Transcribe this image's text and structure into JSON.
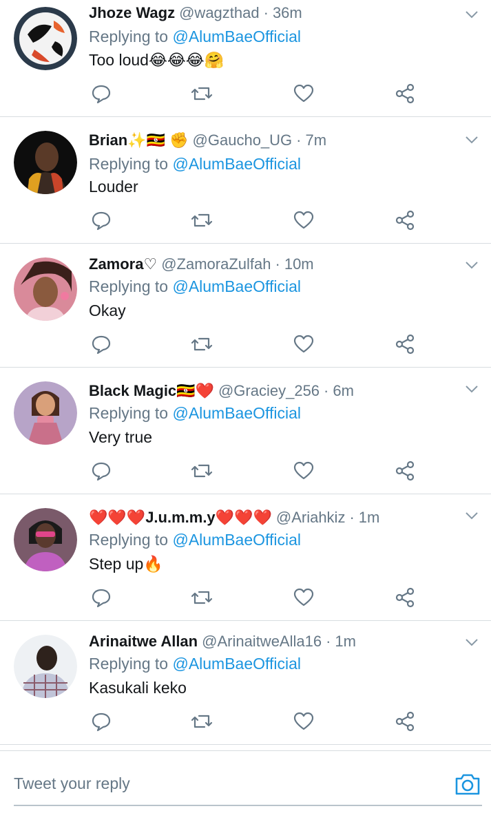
{
  "replies": [
    {
      "name": "Jhoze Wagz",
      "name_emoji": "",
      "handle": "@wagzthad",
      "time": "36m",
      "replying_label": "Replying to",
      "mention": "@AlumBaeOfficial",
      "text": "Too loud😂😂😂🤗",
      "avatar_icon": "ball-avatar"
    },
    {
      "name": "Brian",
      "name_emoji": "✨🇺🇬 ✊",
      "handle": "@Gaucho_UG",
      "time": "7m",
      "replying_label": "Replying to",
      "mention": "@AlumBaeOfficial",
      "text": "Louder",
      "avatar_icon": "person-avatar"
    },
    {
      "name": "Zamora",
      "name_emoji": "♡",
      "handle": "@ZamoraZulfah",
      "time": "10m",
      "replying_label": "Replying to",
      "mention": "@AlumBaeOfficial",
      "text": "Okay",
      "avatar_icon": "person-avatar"
    },
    {
      "name": "Black Magic",
      "name_emoji": "🇺🇬❤️",
      "handle": "@Graciey_256",
      "time": "6m",
      "replying_label": "Replying to",
      "mention": "@AlumBaeOfficial",
      "text": "Very true",
      "avatar_icon": "doll-avatar"
    },
    {
      "name": "J.u.m.m.y",
      "name_prefix_emoji": "❤️❤️❤️",
      "name_emoji": "❤️❤️❤️",
      "handle": "@Ariahkiz",
      "time": "1m",
      "replying_label": "Replying to",
      "mention": "@AlumBaeOfficial",
      "text": "Step up🔥",
      "avatar_icon": "person-avatar"
    },
    {
      "name": "Arinaitwe Allan",
      "name_emoji": "",
      "handle": "@ArinaitweAlla16",
      "time": "1m",
      "replying_label": "Replying to",
      "mention": "@AlumBaeOfficial",
      "text": "Kasukali keko",
      "avatar_icon": "person-avatar"
    }
  ],
  "composer": {
    "placeholder": "Tweet your reply"
  },
  "colors": {
    "link": "#1b95e0",
    "secondary_text": "#657786",
    "divider": "#d7dce0"
  }
}
